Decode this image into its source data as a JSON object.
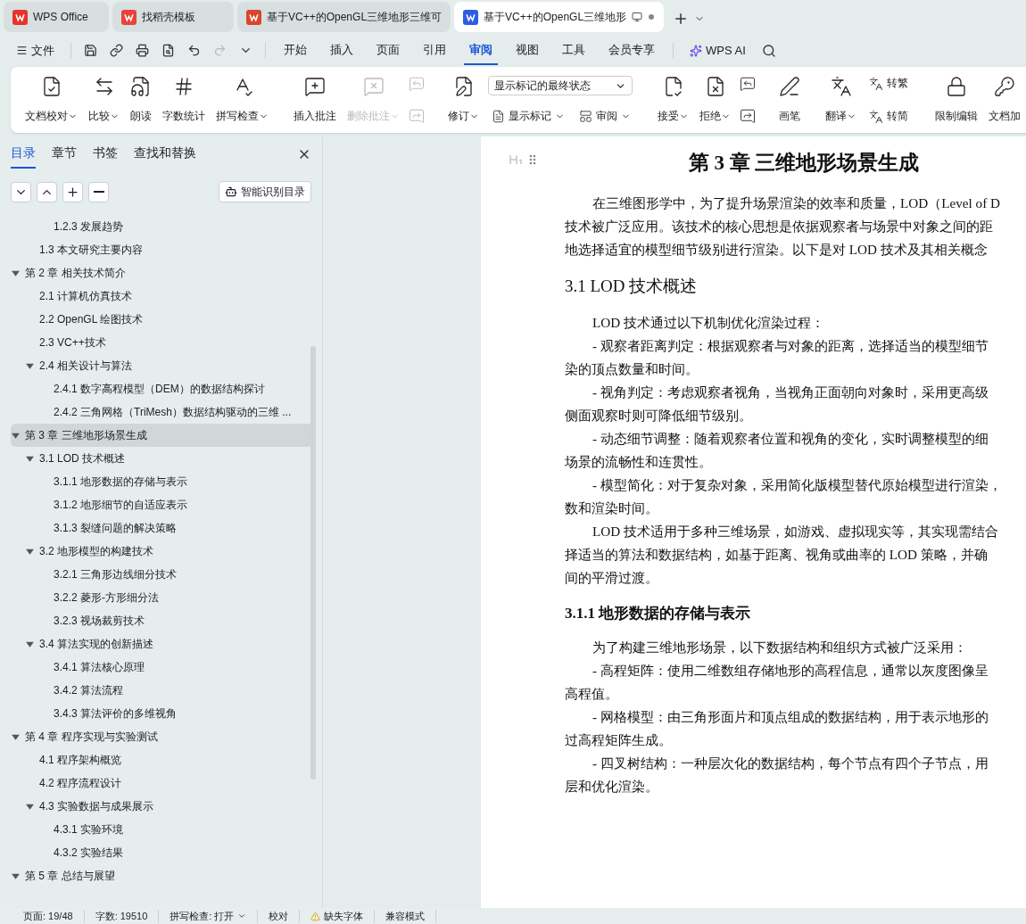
{
  "browser_tabs": [
    {
      "kind": "wps",
      "label": "WPS Office",
      "selected": false
    },
    {
      "kind": "template",
      "label": "找稻壳模板",
      "selected": false
    },
    {
      "kind": "slides",
      "label": "基于VC++的OpenGL三维地形三维可",
      "selected": false
    },
    {
      "kind": "writer",
      "label": "基于VC++的OpenGL三维地形",
      "selected": true
    }
  ],
  "menu": {
    "file": "文件",
    "tabs": [
      {
        "label": "开始",
        "selected": false
      },
      {
        "label": "插入",
        "selected": false
      },
      {
        "label": "页面",
        "selected": false
      },
      {
        "label": "引用",
        "selected": false
      },
      {
        "label": "审阅",
        "selected": true
      },
      {
        "label": "视图",
        "selected": false
      },
      {
        "label": "工具",
        "selected": false
      },
      {
        "label": "会员专享",
        "selected": false
      }
    ],
    "ai": "WPS AI"
  },
  "ribbon": [
    {
      "kind": "big",
      "label": "文档校对",
      "caret": true,
      "disabled": false
    },
    {
      "kind": "big",
      "label": "比较",
      "caret": true,
      "disabled": false
    },
    {
      "kind": "big",
      "label": "朗读",
      "caret": false,
      "disabled": false
    },
    {
      "kind": "big",
      "label": "字数统计",
      "caret": false,
      "disabled": false
    },
    {
      "kind": "big",
      "label": "拼写检查",
      "caret": true,
      "disabled": false
    },
    {
      "kind": "sep"
    },
    {
      "kind": "big",
      "label": "插入批注",
      "caret": false,
      "disabled": false
    },
    {
      "kind": "big",
      "label": "删除批注",
      "caret": true,
      "disabled": true
    },
    {
      "kind": "pair",
      "disabled": true
    },
    {
      "kind": "sep"
    },
    {
      "kind": "big",
      "label": "修订",
      "caret": true,
      "disabled": false
    },
    {
      "kind": "markup",
      "select": "显示标记的最终状态",
      "items": [
        {
          "label": "显示标记"
        },
        {
          "label": "审阅"
        }
      ]
    },
    {
      "kind": "sep"
    },
    {
      "kind": "big",
      "label": "接受",
      "caret": true,
      "disabled": false
    },
    {
      "kind": "big",
      "label": "拒绝",
      "caret": true,
      "disabled": false
    },
    {
      "kind": "pair",
      "disabled": false
    },
    {
      "kind": "sep"
    },
    {
      "kind": "big",
      "label": "画笔",
      "caret": false,
      "disabled": false
    },
    {
      "kind": "sep"
    },
    {
      "kind": "big",
      "label": "翻译",
      "caret": true,
      "disabled": false
    },
    {
      "kind": "stack",
      "items": [
        {
          "label": "转繁"
        },
        {
          "label": "转简"
        }
      ]
    },
    {
      "kind": "sep"
    },
    {
      "kind": "big",
      "label": "限制编辑",
      "caret": false,
      "disabled": false
    },
    {
      "kind": "big",
      "label": "文档加",
      "caret": false,
      "disabled": false
    }
  ],
  "sidebar": {
    "tabs": [
      {
        "label": "目录",
        "selected": true
      },
      {
        "label": "章节",
        "selected": false
      },
      {
        "label": "书签",
        "selected": false
      },
      {
        "label": "查找和替换",
        "selected": false
      }
    ],
    "smart_button": "智能识别目录",
    "toc": [
      {
        "children": [
          {
            "children": [
              {
                "label": "1.2.3  发展趋势",
                "selected": false
              }
            ]
          },
          {
            "label": "1.3  本文研究主要内容",
            "selected": false
          }
        ]
      },
      {
        "label": "第 2 章  相关技术简介",
        "selected": false,
        "expanded": true,
        "children": [
          {
            "label": "2.1  计算机仿真技术",
            "selected": false
          },
          {
            "label": "2.2 OpenGL 绘图技术",
            "selected": false
          },
          {
            "label": "2.3 VC++技术",
            "selected": false
          },
          {
            "label": "2.4  相关设计与算法",
            "selected": false,
            "expanded": true,
            "children": [
              {
                "label": "2.4.1  数字高程模型（DEM）的数据结构探讨",
                "selected": false
              },
              {
                "label": "2.4.2  三角网格（TriMesh）数据结构驱动的三维 ...",
                "selected": false
              }
            ]
          }
        ]
      },
      {
        "label": "第 3 章  三维地形场景生成",
        "selected": true,
        "expanded": true,
        "children": [
          {
            "label": "3.1 LOD 技术概述",
            "selected": false,
            "expanded": true,
            "children": [
              {
                "label": "3.1.1  地形数据的存储与表示",
                "selected": false
              },
              {
                "label": "3.1.2  地形细节的自适应表示",
                "selected": false
              },
              {
                "label": "3.1.3  裂缝问题的解决策略",
                "selected": false
              }
            ]
          },
          {
            "label": "3.2  地形模型的构建技术",
            "selected": false,
            "expanded": true,
            "children": [
              {
                "label": "3.2.1  三角形边线细分技术",
                "selected": false
              },
              {
                "label": "3.2.2  菱形-方形细分法",
                "selected": false
              },
              {
                "label": "3.2.3  视场裁剪技术",
                "selected": false
              }
            ]
          },
          {
            "label": "3.4  算法实现的创新描述",
            "selected": false,
            "expanded": true,
            "children": [
              {
                "label": "3.4.1  算法核心原理",
                "selected": false
              },
              {
                "label": "3.4.2  算法流程",
                "selected": false
              },
              {
                "label": "3.4.3  算法评价的多维视角",
                "selected": false
              }
            ]
          }
        ]
      },
      {
        "label": "第 4 章  程序实现与实验测试",
        "selected": false,
        "expanded": true,
        "children": [
          {
            "label": "4.1  程序架构概览",
            "selected": false
          },
          {
            "label": "4.2  程序流程设计",
            "selected": false
          },
          {
            "label": "4.3  实验数据与成果展示",
            "selected": false,
            "expanded": true,
            "children": [
              {
                "label": "4.3.1  实验环境",
                "selected": false
              },
              {
                "label": "4.3.2  实验结果",
                "selected": false
              }
            ]
          }
        ]
      },
      {
        "label": "第 5 章  总结与展望",
        "selected": false,
        "expanded": true
      }
    ]
  },
  "document": {
    "title": "第 3 章  三维地形场景生成",
    "blocks": [
      {
        "kind": "para",
        "lines": [
          "在三维图形学中，为了提升场景渲染的效率和质量，LOD（Level of D",
          "技术被广泛应用。该技术的核心思想是依据观察者与场景中对象之间的距",
          "地选择适宜的模型细节级别进行渲染。以下是对 LOD 技术及其相关概念"
        ]
      },
      {
        "kind": "heading",
        "text": "3.1 LOD 技术概述"
      },
      {
        "kind": "para",
        "lines": [
          "LOD 技术通过以下机制优化渲染过程："
        ]
      },
      {
        "kind": "para",
        "lines": [
          "- 观察者距离判定：根据观察者与对象的距离，选择适当的模型细节",
          "染的顶点数量和时间。"
        ]
      },
      {
        "kind": "para",
        "lines": [
          "- 视角判定：考虑观察者视角，当视角正面朝向对象时，采用更高级",
          "侧面观察时则可降低细节级别。"
        ]
      },
      {
        "kind": "para",
        "lines": [
          "- 动态细节调整：随着观察者位置和视角的变化，实时调整模型的细",
          "场景的流畅性和连贯性。"
        ]
      },
      {
        "kind": "para",
        "lines": [
          "- 模型简化：对于复杂对象，采用简化版模型替代原始模型进行渲染，",
          "数和渲染时间。"
        ]
      },
      {
        "kind": "para",
        "lines": [
          "LOD 技术适用于多种三维场景，如游戏、虚拟现实等，其实现需结合",
          "择适当的算法和数据结构，如基于距离、视角或曲率的 LOD 策略，并确",
          "间的平滑过渡。"
        ]
      },
      {
        "kind": "subheading",
        "text": "3.1.1  地形数据的存储与表示"
      },
      {
        "kind": "para",
        "lines": [
          "为了构建三维地形场景，以下数据结构和组织方式被广泛采用："
        ]
      },
      {
        "kind": "para",
        "lines": [
          "- 高程矩阵：使用二维数组存储地形的高程信息，通常以灰度图像呈",
          "高程值。"
        ]
      },
      {
        "kind": "para",
        "lines": [
          "- 网格模型：由三角形面片和顶点组成的数据结构，用于表示地形的",
          "过高程矩阵生成。"
        ]
      },
      {
        "kind": "para",
        "lines": [
          "- 四叉树结构：一种层次化的数据结构，每个节点有四个子节点，用",
          "层和优化渲染。"
        ]
      }
    ]
  },
  "status_bar": [
    {
      "kind": "text",
      "label": "页面: 19/48"
    },
    {
      "kind": "text",
      "label": "字数: 19510"
    },
    {
      "kind": "dropdown",
      "label": "拼写检查: 打开"
    },
    {
      "kind": "text",
      "label": "校对"
    },
    {
      "kind": "warning",
      "label": "缺失字体"
    },
    {
      "kind": "text",
      "label": "兼容模式"
    }
  ]
}
